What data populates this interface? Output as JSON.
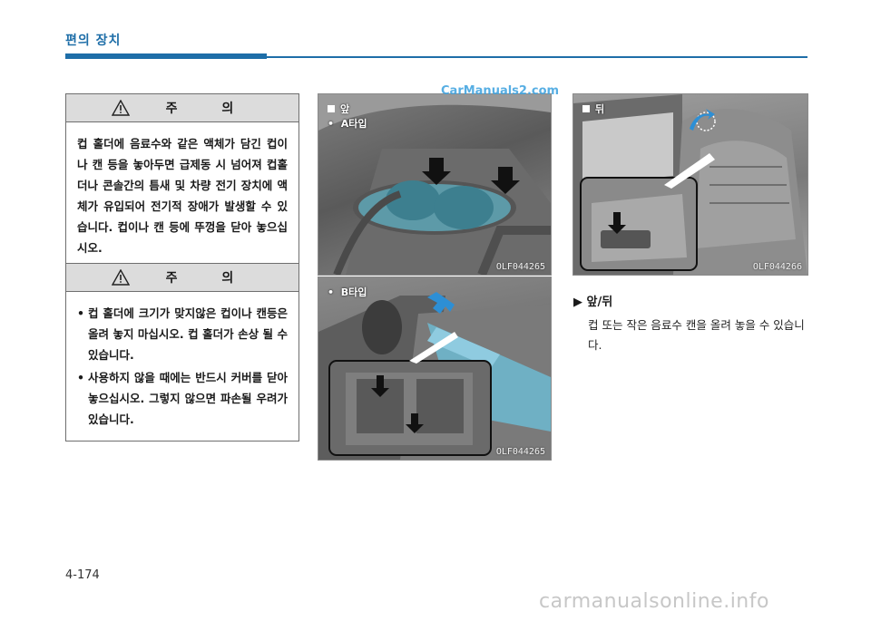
{
  "header": {
    "title": "편의 장치"
  },
  "caution1": {
    "title": "주 의",
    "body": "컵 홀더에 음료수와 같은 액체가 담긴 컵이나 캔 등을 놓아두면 급제동 시 넘어져 컵홀더나 콘솔간의 틈새 및 차량 전기 장치에 액체가 유입되어 전기적 장애가 발생할 수 있습니다. 컵이나 캔 등에 뚜껑을 닫아 놓으십시오."
  },
  "caution2": {
    "title": "주 의",
    "items": [
      "컵 홀더에 크기가 맞지않은 컵이나 캔등은 올려 놓지 마십시오. 컵 홀더가 손상 될 수 있습니다.",
      "사용하지 않을 때에는 반드시 커버를 닫아놓으십시오. 그렇지 않으면 파손될 우려가 있습니다."
    ]
  },
  "photos": {
    "front_a": {
      "label_front": "앞",
      "label_type": "A타입",
      "code": "OLF044265"
    },
    "front_b": {
      "label_type": "B타입",
      "code": "OLF044265"
    },
    "rear": {
      "label_rear": "뒤",
      "code": "OLF044266"
    }
  },
  "watermark_top": "CarManuals2.com",
  "section": {
    "title": "앞/뒤",
    "body": "컵 또는 작은 음료수 캔을 올려 놓을 수 있습니다."
  },
  "footer": {
    "page": "4-174",
    "site": "carmanualsonline.info"
  }
}
